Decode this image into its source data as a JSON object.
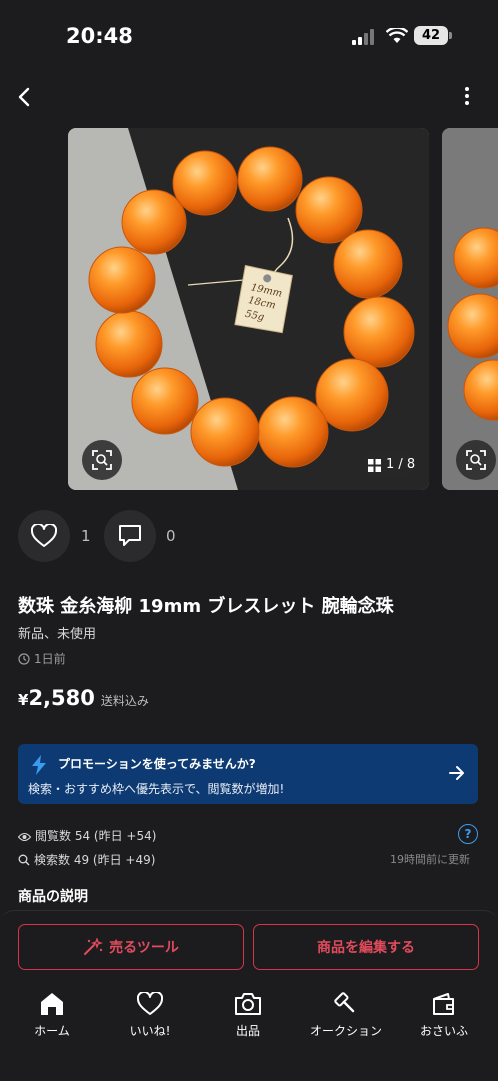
{
  "status_bar": {
    "time": "20:48",
    "battery": "42"
  },
  "gallery": {
    "counter": "1 / 8",
    "tag_text": "19mm\n18cm\n55g"
  },
  "social": {
    "likes": "1",
    "comments": "0"
  },
  "item": {
    "title": "数珠 金糸海柳 19mm ブレスレット 腕輪念珠",
    "condition": "新品、未使用",
    "posted": "1日前",
    "price_currency": "¥",
    "price": "2,580",
    "shipping": "送料込み"
  },
  "promo": {
    "title": "プロモーションを使ってみませんか?",
    "description": "検索・おすすめ枠へ優先表示で、閲覧数が増加!"
  },
  "stats": {
    "views": "閲覧数  54 (昨日 +54)",
    "searches": "検索数  49 (昨日 +49)",
    "help": "?",
    "updated": "19時間前に更新"
  },
  "description_heading": "商品の説明",
  "actions": {
    "sell_tools": "売るツール",
    "edit_item": "商品を編集する"
  },
  "tabs": [
    {
      "label": "ホーム",
      "icon": "home-icon"
    },
    {
      "label": "いいね!",
      "icon": "heart-icon"
    },
    {
      "label": "出品",
      "icon": "camera-icon"
    },
    {
      "label": "オークション",
      "icon": "gavel-icon"
    },
    {
      "label": "おさいふ",
      "icon": "wallet-icon"
    }
  ],
  "colors": {
    "accent_red": "#e14b5c",
    "promo_bg": "#0d3a72",
    "link_blue": "#3b9bf0",
    "bead_orange": "#f08a1e"
  }
}
